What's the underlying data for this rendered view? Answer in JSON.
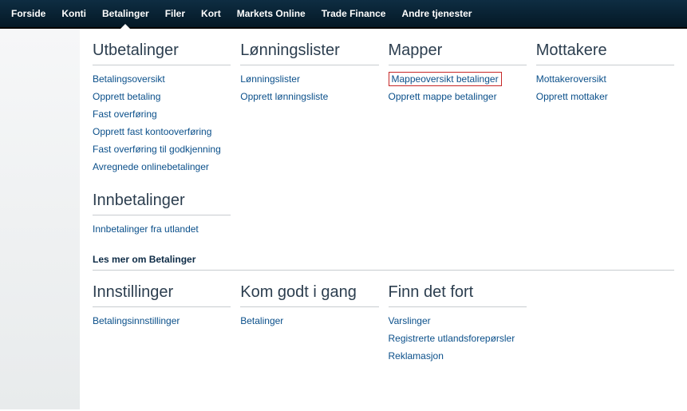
{
  "topnav": {
    "items": [
      {
        "label": "Forside"
      },
      {
        "label": "Konti"
      },
      {
        "label": "Betalinger",
        "active": true
      },
      {
        "label": "Filer"
      },
      {
        "label": "Kort"
      },
      {
        "label": "Markets Online"
      },
      {
        "label": "Trade Finance"
      },
      {
        "label": "Andre tjenester"
      }
    ]
  },
  "content": {
    "row1": {
      "utbetalinger": {
        "title": "Utbetalinger",
        "links": [
          "Betalingsoversikt",
          "Opprett betaling",
          "Fast overføring",
          "Opprett fast kontooverføring",
          "Fast overføring til godkjenning",
          "Avregnede onlinebetalinger"
        ]
      },
      "innbetalinger": {
        "title": "Innbetalinger",
        "links": [
          "Innbetalinger fra utlandet"
        ]
      },
      "les_mer": "Les mer om Betalinger",
      "lonningslister": {
        "title": "Lønningslister",
        "links": [
          "Lønningslister",
          "Opprett lønningsliste"
        ]
      },
      "mapper": {
        "title": "Mapper",
        "links": [
          "Mappeoversikt betalinger",
          "Opprett mappe betalinger"
        ],
        "highlight_index": 0
      },
      "mottakere": {
        "title": "Mottakere",
        "links": [
          "Mottakeroversikt",
          "Opprett mottaker"
        ]
      }
    },
    "row2": {
      "innstillinger": {
        "title": "Innstillinger",
        "links": [
          "Betalingsinnstillinger"
        ]
      },
      "kom_godt": {
        "title": "Kom godt i gang",
        "links": [
          "Betalinger"
        ]
      },
      "finn_det_fort": {
        "title": "Finn det fort",
        "links": [
          "Varslinger",
          "Registrerte utlandsforepørsler",
          "Reklamasjon"
        ]
      }
    }
  }
}
